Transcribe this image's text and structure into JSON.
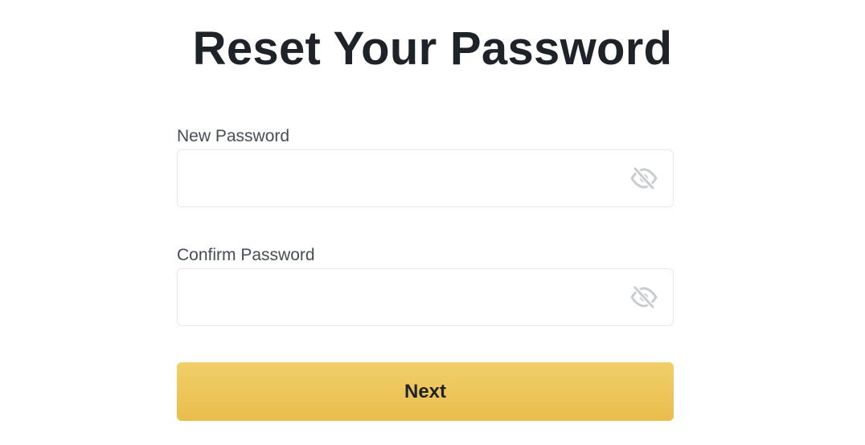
{
  "page": {
    "title": "Reset Your Password"
  },
  "form": {
    "new_password": {
      "label": "New Password",
      "value": "",
      "placeholder": "",
      "toggle_icon": "eye-slash-icon"
    },
    "confirm_password": {
      "label": "Confirm Password",
      "value": "",
      "placeholder": "",
      "toggle_icon": "eye-slash-icon"
    },
    "next_label": "Next"
  },
  "colors": {
    "title": "#1e2329",
    "label": "#474d57",
    "input_border": "#e6e8ea",
    "icon": "#c9ccd1",
    "button_top": "#f1cf6a",
    "button_bottom": "#e9bd4c",
    "button_text": "#1e2329"
  }
}
